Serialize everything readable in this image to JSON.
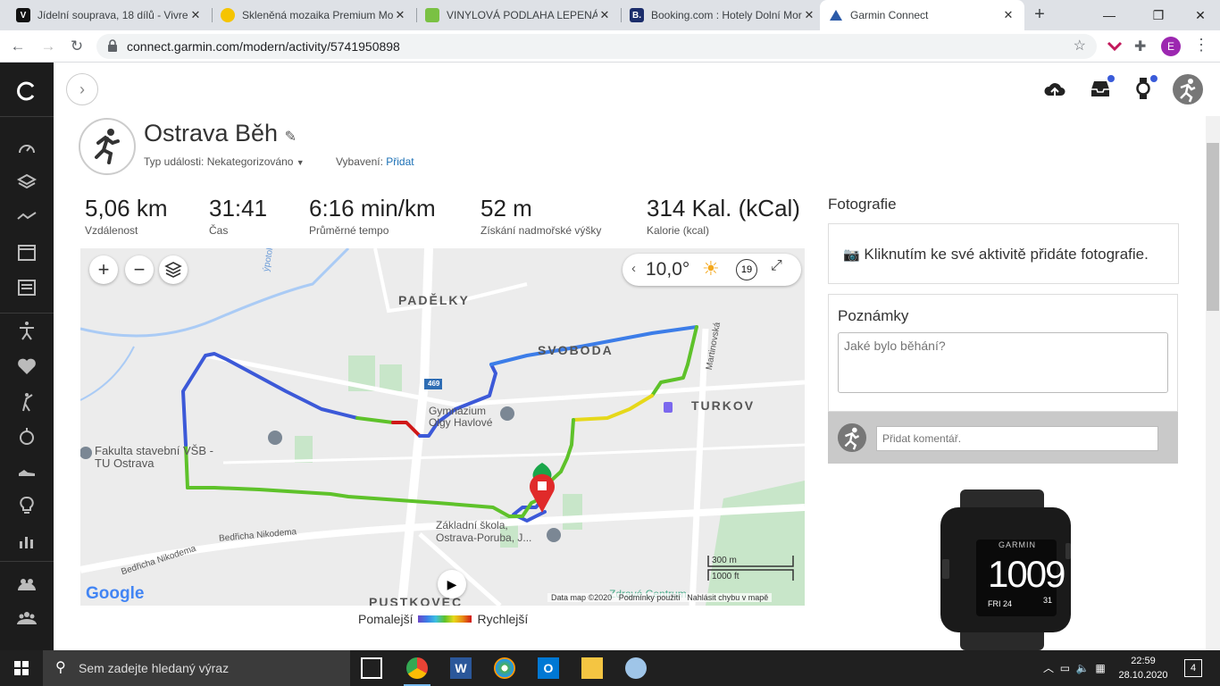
{
  "browser": {
    "tabs": [
      {
        "title": "Jídelní souprava, 18 dílů - Vivre",
        "favicon": "V",
        "color": "#111111"
      },
      {
        "title": "Skleněná mozaika Premium Mosaic",
        "favicon": "",
        "color": "#f5c400"
      },
      {
        "title": "VINYLOVÁ PODLAHA LEPENÁ",
        "favicon": "",
        "color": "#7ac143"
      },
      {
        "title": "Booking.com : Hotely Dolní Morava",
        "favicon": "B.",
        "color": "#1b2d6b"
      },
      {
        "title": "Garmin Connect",
        "favicon": "",
        "color": "#2b5aa8"
      }
    ],
    "url": "connect.garmin.com/modern/activity/5741950898",
    "profile_initial": "E"
  },
  "activity": {
    "title": "Ostrava Běh",
    "event_type_label": "Typ události:",
    "event_type_value": "Nekategorizováno",
    "gear_label": "Vybavení:",
    "gear_link": "Přidat"
  },
  "stats": [
    {
      "value": "5,06 km",
      "label": "Vzdálenost"
    },
    {
      "value": "31:41",
      "label": "Čas"
    },
    {
      "value": "6:16 min/km",
      "label": "Průměrné tempo"
    },
    {
      "value": "52 m",
      "label": "Získání nadmořské výšky"
    },
    {
      "value": "314 Kal. (kCal)",
      "label": "Kalorie (kcal)"
    }
  ],
  "map": {
    "zoom_in": "+",
    "zoom_out": "−",
    "temperature": "10,0°",
    "wind_speed": "19",
    "labels": {
      "padelky": "PADĚLKY",
      "svoboda": "SVOBODA",
      "turkov": "TURKOV",
      "pustkovec": "PUSTKOVEC",
      "gym": "Gymnázium Olgy Havlové",
      "faculty": "Fakulta stavební VŠB - TU Ostrava",
      "school": "Základní škola, Ostrava-Poruba, J...",
      "road469": "469",
      "bedricha": "Bedřicha Nikodema",
      "bedricha2": "Bedřicha Nikodema",
      "martinovska": "Martinovská",
      "potok": "ýpotok",
      "zdrave": "Zdravé Centrum"
    },
    "scale_m": "300 m",
    "scale_ft": "1000 ft",
    "attribution_data": "Data map ©2020",
    "attribution_terms": "Podmínky použití",
    "attribution_report": "Nahlásit chybu v mapě",
    "google": "Google"
  },
  "legend": {
    "slow": "Pomalejší",
    "fast": "Rychlejší"
  },
  "photos": {
    "heading": "Fotografie",
    "prompt": "Kliknutím ke své aktivitě přidáte fotografie."
  },
  "notes": {
    "heading": "Poznámky",
    "placeholder": "Jaké bylo běhání?"
  },
  "comment": {
    "placeholder": "Přidat komentář."
  },
  "watch": {
    "brand": "GARMIN",
    "time": "1009",
    "day": "FRI 24",
    "num": "31"
  },
  "taskbar": {
    "search_placeholder": "Sem zadejte hledaný výraz",
    "time": "22:59",
    "date": "28.10.2020",
    "notifications": "4"
  }
}
